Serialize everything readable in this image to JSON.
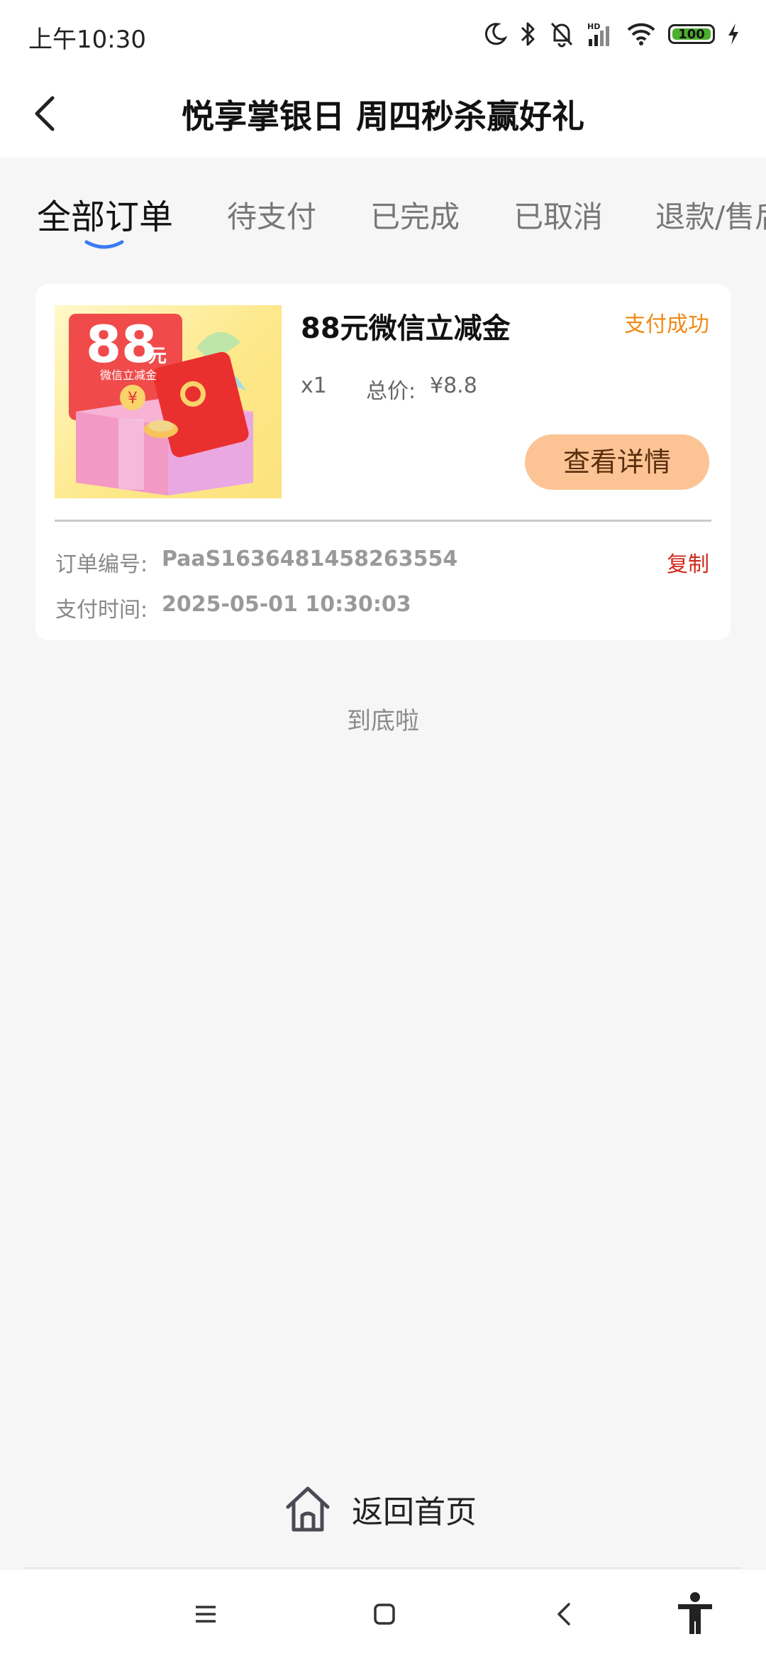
{
  "status_bar": {
    "time": "上午10:30",
    "icons": [
      "moon-icon",
      "bluetooth-icon",
      "mute-bell-icon",
      "signal-icon",
      "wifi-icon",
      "battery-icon",
      "charging-icon"
    ],
    "signal_badge": "HD",
    "battery_level": "100"
  },
  "header": {
    "title": "悦享掌银日 周四秒杀赢好礼",
    "back_icon": "chevron-left-icon"
  },
  "tabs": [
    {
      "label": "全部订单",
      "active": true
    },
    {
      "label": "待支付",
      "active": false
    },
    {
      "label": "已完成",
      "active": false
    },
    {
      "label": "已取消",
      "active": false
    },
    {
      "label": "退款/售后",
      "active": false
    }
  ],
  "order": {
    "product_name": "88元微信立减金",
    "image_text": {
      "amount": "88",
      "unit": "元",
      "caption": "微信立减金",
      "coin": "¥"
    },
    "status": "支付成功",
    "quantity": "x1",
    "price_label": "总价:",
    "price_value": "¥8.8",
    "detail_button": "查看详情",
    "order_no_label": "订单编号:",
    "order_no_value": "PaaS1636481458263554",
    "copy_label": "复制",
    "pay_time_label": "支付时间:",
    "pay_time_value": "2025-05-01 10:30:03"
  },
  "list_end_text": "到底啦",
  "home_link": {
    "label": "返回首页",
    "icon": "home-icon"
  },
  "nav_bar": {
    "icons": [
      "menu-icon",
      "home-square-icon",
      "back-icon",
      "accessibility-icon"
    ]
  },
  "colors": {
    "accent_orange": "#f08a17",
    "button_bg": "#fcc495",
    "copy_red": "#d02a1e",
    "tab_indicator": "#3a7bf0"
  }
}
